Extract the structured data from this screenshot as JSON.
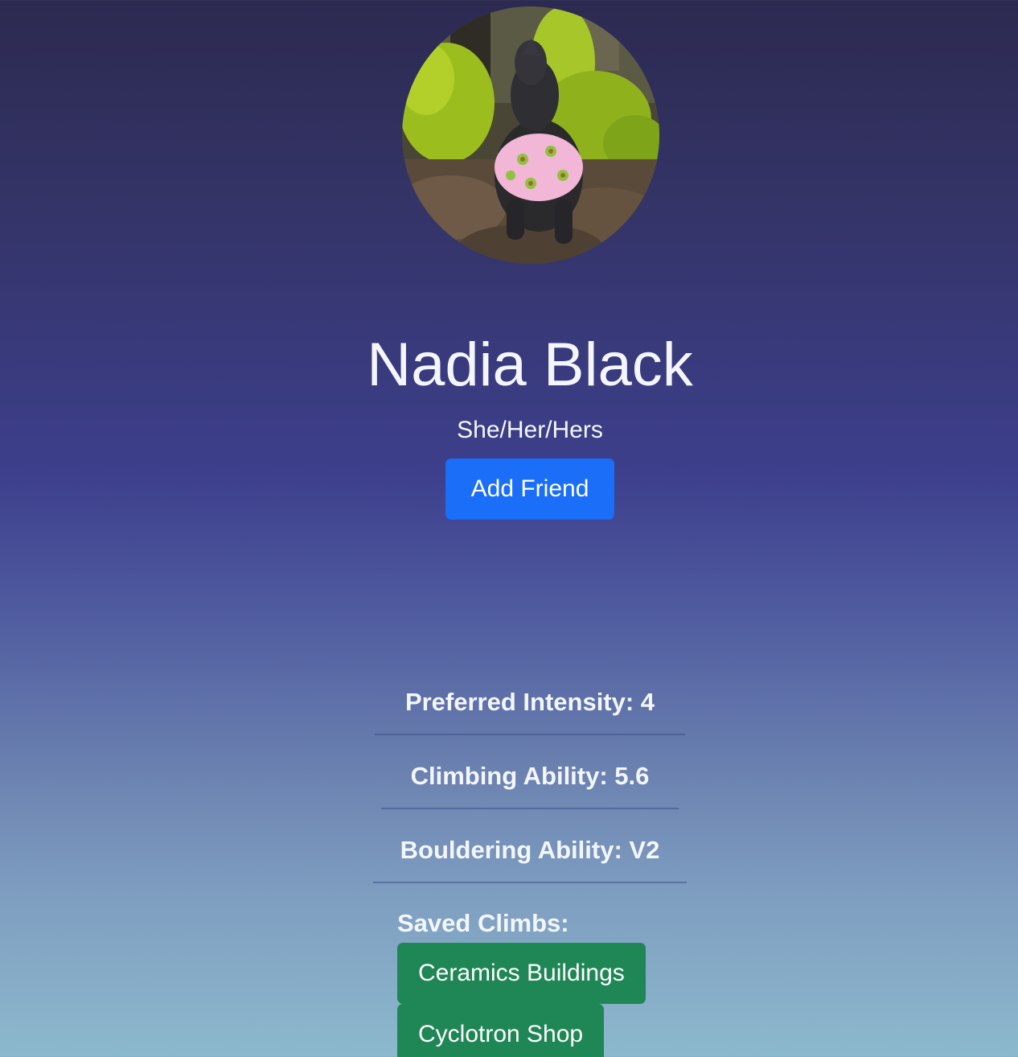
{
  "profile": {
    "avatar_alt": "Profile photo",
    "name": "Nadia Black",
    "pronouns": "She/Her/Hers",
    "add_friend_label": "Add Friend"
  },
  "stats": [
    {
      "label": "Preferred Intensity: 4"
    },
    {
      "label": "Climbing Ability: 5.6"
    },
    {
      "label": "Bouldering Ability: V2"
    }
  ],
  "saved_climbs": {
    "label": "Saved Climbs:",
    "items": [
      {
        "label": "Ceramics Buildings"
      },
      {
        "label": "Cyclotron Shop"
      }
    ]
  },
  "colors": {
    "primary_button": "#1a6ef7",
    "success_button": "#1f8755",
    "text": "#f4f6ff"
  }
}
